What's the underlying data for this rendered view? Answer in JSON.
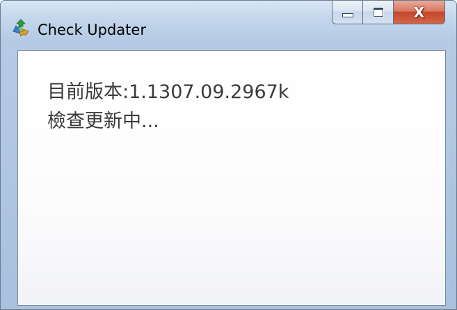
{
  "window": {
    "title": "Check Updater",
    "icon": "recycle-arrows-icon",
    "controls": {
      "minimize_icon": "minimize-icon",
      "maximize_icon": "maximize-icon",
      "close_glyph": "X"
    }
  },
  "content": {
    "version_line": "目前版本:1.1307.09.2967k",
    "status_line": "檢查更新中..."
  },
  "colors": {
    "close_button": "#c4462b",
    "titlebar": "#c2d5eb",
    "text": "#3a3a3a"
  }
}
